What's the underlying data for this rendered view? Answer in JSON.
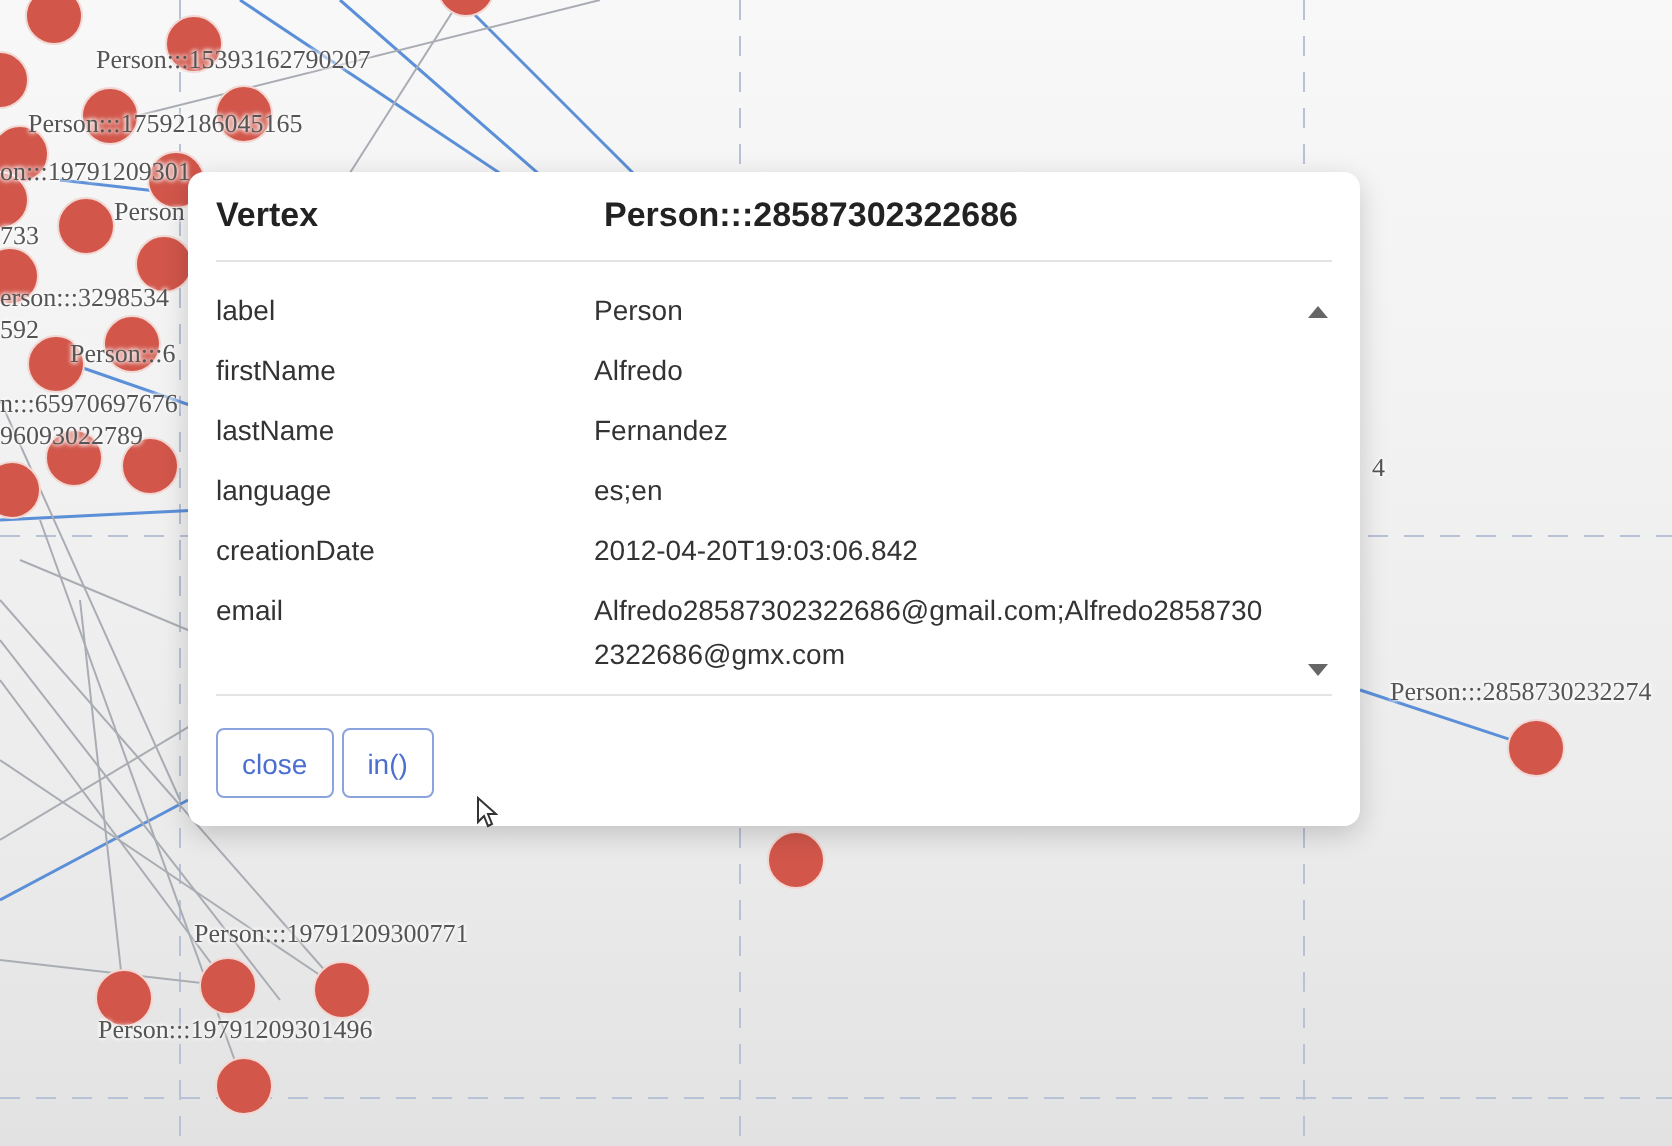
{
  "graph": {
    "node_labels": [
      "Person:::15393162790207",
      "Person:::17592186045165",
      "on:::19791209301",
      "Person",
      "733",
      "erson:::3298534",
      "592",
      "Person:::6",
      "n:::65970697676",
      "96093022789",
      "4",
      "Person:::2858730232274",
      "Person:::19791209300771",
      "Person:::19791209301496"
    ]
  },
  "dialog": {
    "title": "Vertex",
    "vertex_id": "Person:::28587302322686",
    "properties": [
      {
        "key": "label",
        "value": "Person"
      },
      {
        "key": "firstName",
        "value": "Alfredo"
      },
      {
        "key": "lastName",
        "value": "Fernandez"
      },
      {
        "key": "language",
        "value": "es;en"
      },
      {
        "key": "creationDate",
        "value": "2012-04-20T19:03:06.842"
      },
      {
        "key": "email",
        "value": "Alfredo28587302322686@gmail.com;Alfredo28587302322686@gmx.com"
      }
    ],
    "buttons": [
      "close",
      "in()"
    ]
  }
}
